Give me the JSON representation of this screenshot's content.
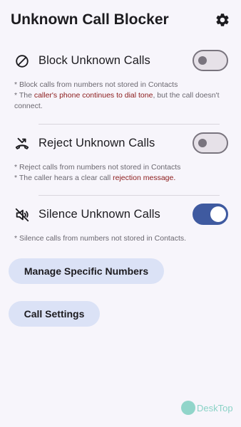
{
  "header": {
    "title": "Unknown Call Blocker",
    "settings_icon": "gear-icon"
  },
  "options": [
    {
      "icon": "block-icon",
      "label": "Block Unknown Calls",
      "enabled": false,
      "desc_line1": "* Block calls from numbers not stored in Contacts",
      "desc_line2_prefix": "* The ",
      "desc_line2_highlight": "caller's phone continues to dial tone",
      "desc_line2_suffix": ", but the call doesn't connect."
    },
    {
      "icon": "call-reject-icon",
      "label": "Reject Unknown Calls",
      "enabled": false,
      "desc_line1": "* Reject calls from numbers not stored in Contacts",
      "desc_line2_prefix": "* The caller hears a clear call ",
      "desc_line2_highlight": "rejection message.",
      "desc_line2_suffix": ""
    },
    {
      "icon": "volume-off-icon",
      "label": "Silence Unknown Calls",
      "enabled": true,
      "desc_line1": "* Silence calls from numbers not stored in Contacts."
    }
  ],
  "buttons": {
    "manage_numbers": "Manage Specific Numbers",
    "call_settings": "Call Settings"
  },
  "watermark": {
    "text": "DeskTop"
  },
  "colors": {
    "accent": "#3f5aa0",
    "button_bg": "#dbe2f6",
    "highlight_text": "#8b1a1a",
    "background": "#f7f5fb"
  }
}
